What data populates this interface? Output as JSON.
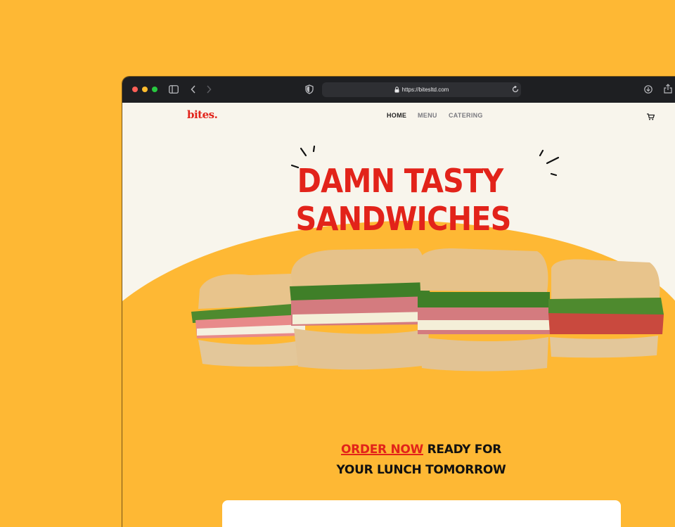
{
  "browser": {
    "url": "https://bitesltd.com"
  },
  "site": {
    "logo": "bites.",
    "nav": {
      "home": "HOME",
      "menu": "MENU",
      "catering": "CATERING"
    },
    "cart_icon": "cart-icon"
  },
  "hero": {
    "line1": "DAMN TASTY",
    "line2": "SANDWICHES"
  },
  "order": {
    "cta": "ORDER NOW",
    "line1_rest": "READY FOR",
    "line2": "YOUR LUNCH TOMORROW"
  },
  "colors": {
    "brand_red": "#E2231A",
    "background_yellow": "#FEB834",
    "cream": "#F8F5EC",
    "toolbar": "#1E1F22"
  }
}
